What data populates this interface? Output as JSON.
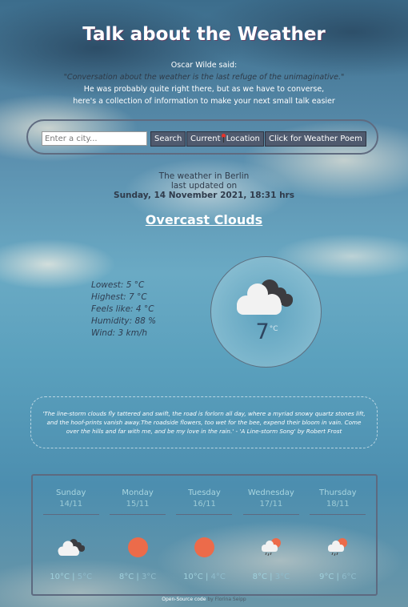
{
  "header": {
    "title": "Talk about the Weather",
    "intro_attribution": "Oscar Wilde said:",
    "intro_quote": "\"Conversation about the weather is the last refuge of the unimaginative.\"",
    "intro_line1": "He was probably quite right there, but as we have to converse,",
    "intro_line2": "here's a collection of information to make your next small talk easier"
  },
  "search": {
    "placeholder": "Enter a city...",
    "value": "",
    "search_label": "Search",
    "current_label_part1": "Current",
    "current_label_part2": "Location",
    "poem_label": "Click for Weather Poem"
  },
  "location": {
    "prefix": "The weather in",
    "city": "Berlin",
    "updated_label": "last updated on",
    "date": "Sunday, 14 November 2021, 18:31 hrs"
  },
  "current": {
    "description": "Overcast Clouds",
    "lowest": "Lowest: 5 °C",
    "highest": "Highest: 7 °C",
    "feels_like": "Feels like: 4 °C",
    "humidity": "Humidity: 88 %",
    "wind": "Wind: 3 km/h",
    "temperature": "7",
    "unit": "°C",
    "icon": "overcast-clouds-icon"
  },
  "poem": {
    "text": "'The line-storm clouds fly tattered and swift, the road is forlorn all day, where a myriad snowy quartz stones lift, and the hoof-prints vanish away.The roadside flowers, too wet for the bee, expend their bloom in vain. Come over the hills and far with me, and be my love in the rain.' - 'A Line-storm Song' by Robert Frost"
  },
  "forecast": [
    {
      "day": "Sunday",
      "date": "14/11",
      "max": "10°C",
      "min": "5°C",
      "icon": "cloudy"
    },
    {
      "day": "Monday",
      "date": "15/11",
      "max": "8°C",
      "min": "3°C",
      "icon": "sunny"
    },
    {
      "day": "Tuesday",
      "date": "16/11",
      "max": "10°C",
      "min": "4°C",
      "icon": "sunny"
    },
    {
      "day": "Wednesday",
      "date": "17/11",
      "max": "8°C",
      "min": "3°C",
      "icon": "rain-sun"
    },
    {
      "day": "Thursday",
      "date": "18/11",
      "max": "9°C",
      "min": "6°C",
      "icon": "rain-sun"
    }
  ],
  "footer": {
    "link_label": "Open-Source code",
    "author": "by Florina Seipp"
  },
  "colors": {
    "accent_sun": "#ec6b4a",
    "button_bg": "#4f5a6e",
    "pin": "#e8332a"
  }
}
